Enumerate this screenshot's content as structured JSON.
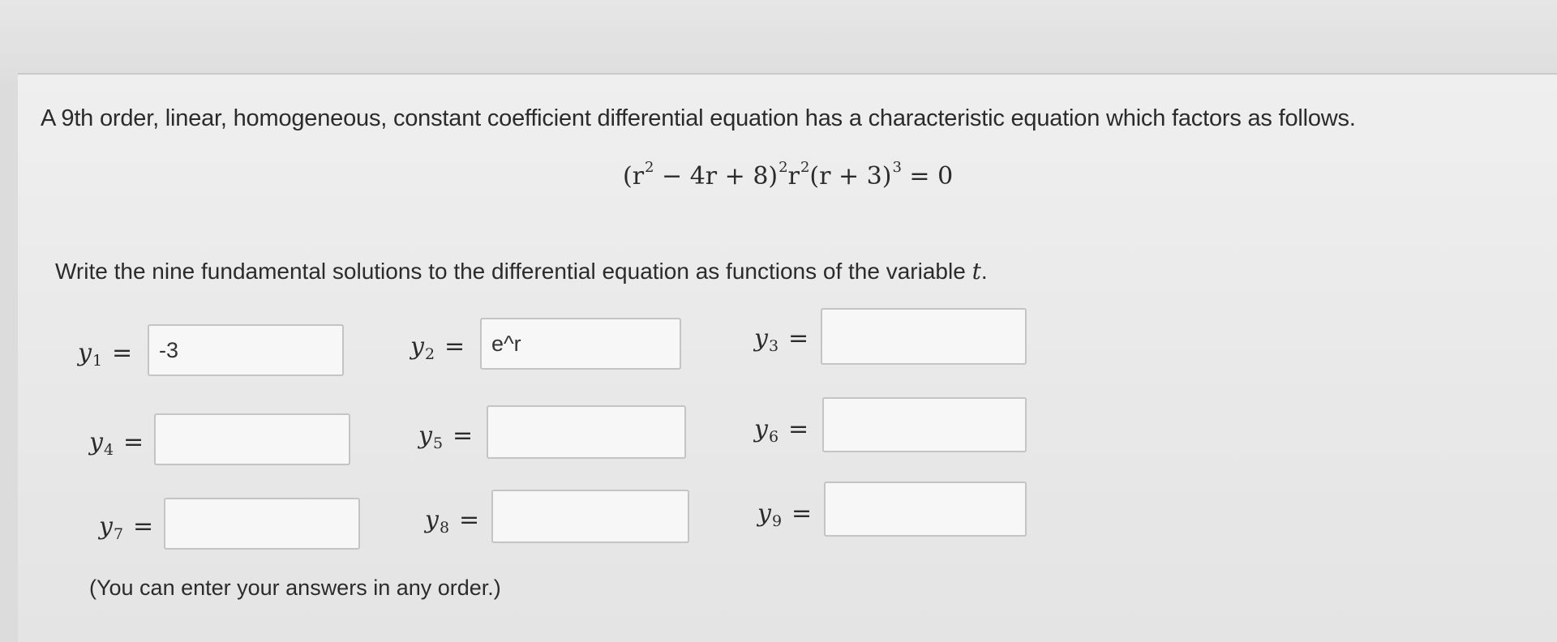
{
  "question": {
    "text": "A 9th order, linear, homogeneous, constant coefficient differential equation has a characteristic equation which factors as follows.",
    "equation": {
      "part1": "(r",
      "pow1": "2",
      "part2": " − 4r + 8)",
      "pow2": "2",
      "part3": "r",
      "pow3": "2",
      "part4": "(r + 3)",
      "pow4": "3",
      "part5": " = 0"
    },
    "instruction_prefix": "Write the nine fundamental solutions to the differential equation as functions of the variable",
    "instruction_var": "t",
    "instruction_suffix": "."
  },
  "answers": [
    {
      "label": "y",
      "sub": "1",
      "eq": "=",
      "value": "-3"
    },
    {
      "label": "y",
      "sub": "2",
      "eq": "=",
      "value": "e^r"
    },
    {
      "label": "y",
      "sub": "3",
      "eq": "=",
      "value": ""
    },
    {
      "label": "y",
      "sub": "4",
      "eq": "=",
      "value": ""
    },
    {
      "label": "y",
      "sub": "5",
      "eq": "=",
      "value": ""
    },
    {
      "label": "y",
      "sub": "6",
      "eq": "=",
      "value": ""
    },
    {
      "label": "y",
      "sub": "7",
      "eq": "=",
      "value": ""
    },
    {
      "label": "y",
      "sub": "8",
      "eq": "=",
      "value": ""
    },
    {
      "label": "y",
      "sub": "9",
      "eq": "=",
      "value": ""
    }
  ],
  "note": "(You can enter your answers in any order.)"
}
